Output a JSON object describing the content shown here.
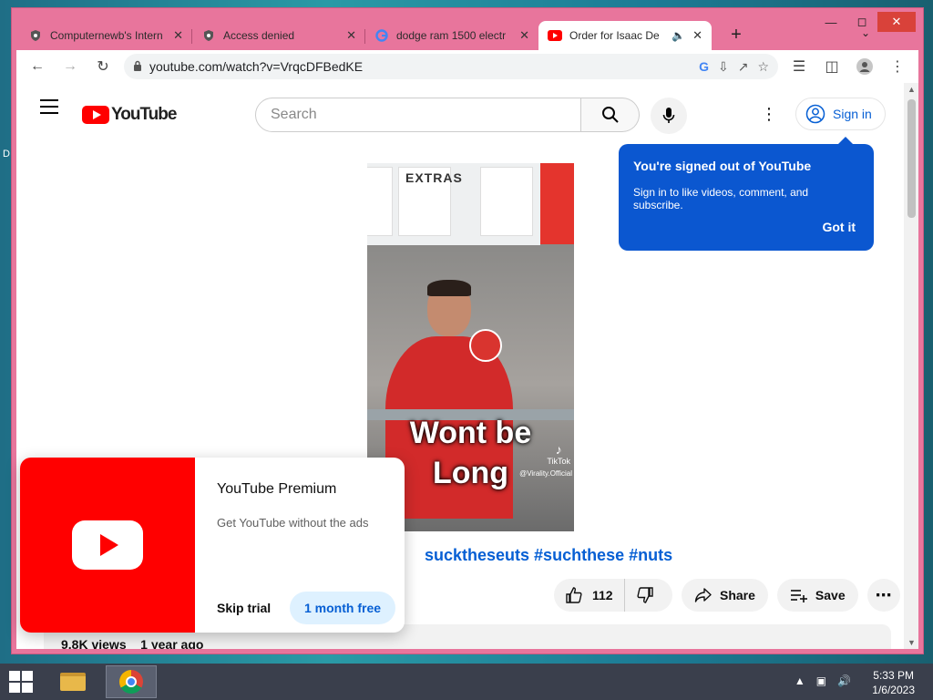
{
  "desktop": {
    "edge_mark": "D"
  },
  "browser": {
    "tabs": [
      {
        "title": "Computernewb's Intern",
        "favicon": "shield-icon"
      },
      {
        "title": "Access denied",
        "favicon": "shield-icon"
      },
      {
        "title": "dodge ram 1500 electr",
        "favicon": "google-icon"
      },
      {
        "title": "Order for Isaac De",
        "favicon": "youtube-icon",
        "active": true,
        "audio": true
      }
    ],
    "url": "youtube.com/watch?v=VrqcDFBedKE"
  },
  "youtube": {
    "logo_text": "YouTube",
    "search_placeholder": "Search",
    "signin_label": "Sign in",
    "tooltip": {
      "title": "You're signed out of YouTube",
      "body": "Sign in to like videos, comment, and subscribe.",
      "button": "Got it"
    },
    "video": {
      "board_text": "EXTRAS",
      "caption_line1": "Wont be",
      "caption_line2": "Long",
      "tiktok": "TikTok",
      "tiktok_handle": "@Virality.Official"
    },
    "hashtags": "sucktheseuts #suchthese #nuts",
    "likes": "112",
    "share_label": "Share",
    "save_label": "Save",
    "views": "9.8K views",
    "time_ago": "1 year ago",
    "promo": {
      "title": "YouTube Premium",
      "desc": "Get YouTube without the ads",
      "skip": "Skip trial",
      "trial": "1 month free"
    }
  },
  "taskbar": {
    "time": "5:33 PM",
    "date": "1/6/2023"
  },
  "colors": {
    "window_frame": "#e8759c",
    "youtube_red": "#ff0000",
    "link_blue": "#065fd4",
    "tooltip_blue": "#0b57d0"
  }
}
